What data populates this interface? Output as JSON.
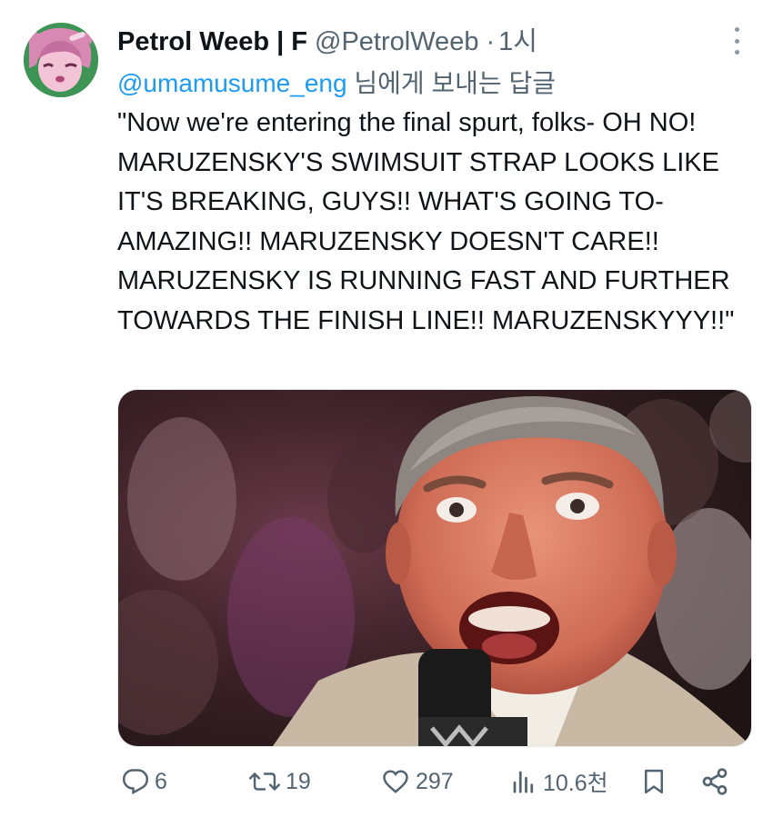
{
  "author": {
    "display_name": "Petrol Weeb | F",
    "handle": "@PetrolWeeb",
    "separator": "·",
    "time": "1시"
  },
  "reply_to": {
    "mention": "@umamusume_eng",
    "suffix": " 님에게 보내는 답글"
  },
  "tweet_text": "\"Now we're entering the final spurt, folks- OH NO! MARUZENSKY'S SWIMSUIT STRAP LOOKS LIKE IT'S BREAKING, GUYS!! WHAT'S GOING TO- AMAZING!! MARUZENSKY DOESN'T CARE!! MARUZENSKY IS RUNNING FAST AND FURTHER TOWARDS THE FINISH LINE!! MARUZENSKYYY!!\"",
  "actions": {
    "replies": "6",
    "retweets": "19",
    "likes": "297",
    "views": "10.6천"
  },
  "icons": {
    "reply": "reply-icon",
    "retweet": "retweet-icon",
    "like": "heart-icon",
    "views": "views-icon",
    "bookmark": "bookmark-icon",
    "share": "share-icon",
    "more": "more-options-icon"
  },
  "colors": {
    "text": "#0f1419",
    "secondary": "#536471",
    "link": "#1d9bf0"
  }
}
